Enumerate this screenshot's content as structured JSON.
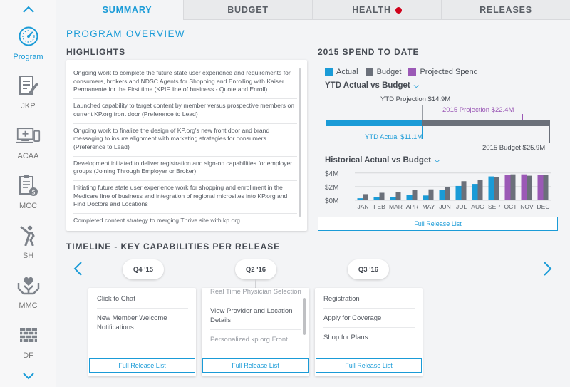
{
  "sidebar": {
    "items": [
      {
        "label": "Program",
        "icon": "gauge-icon"
      },
      {
        "label": "JKP",
        "icon": "document-pen-icon"
      },
      {
        "label": "ACAA",
        "icon": "devices-icon"
      },
      {
        "label": "MCC",
        "icon": "clipboard-dollar-icon"
      },
      {
        "label": "SH",
        "icon": "stretching-person-icon"
      },
      {
        "label": "MMC",
        "icon": "heart-hands-icon"
      },
      {
        "label": "DF",
        "icon": "bricks-icon"
      }
    ]
  },
  "tabs": [
    {
      "label": "SUMMARY"
    },
    {
      "label": "BUDGET"
    },
    {
      "label": "HEALTH"
    },
    {
      "label": "RELEASES"
    }
  ],
  "colors": {
    "accent": "#1a9bd7",
    "actual": "#1a9bd7",
    "budget": "#6b707a",
    "projected": "#9b59b6",
    "health_status": "#d0021b"
  },
  "page_title": "PROGRAM OVERVIEW",
  "highlights": {
    "title": "HIGHLIGHTS",
    "items": [
      "Ongoing work to complete the future state user experience and requirements for consumers, brokers and NDSC Agents for Shopping and Enrolling with Kaiser Permanente for the First time (KPIF line of business - Quote and Enroll)",
      "Launched capability to target content by member versus prospective members on current KP.org front door (Preference to Lead)",
      "Ongoing work to finalize the design of KP.org's new front door and brand messaging to insure alignment with marketing strategies for consumers (Preference to Lead)",
      "Development initiated to deliver registration and sign-on capabilities for employer groups (Joining Through Employer or Broker)",
      "Initiating future state user experience work for shopping and enrollment in the Medicare line of business and integration of regional microsites into KP.org and Find Doctors and Locations",
      "Completed content strategy to merging Thrive site with kp.org."
    ]
  },
  "spend": {
    "title": "2015 SPEND TO DATE",
    "legend": [
      {
        "label": "Actual"
      },
      {
        "label": "Budget"
      },
      {
        "label": "Projected Spend"
      }
    ],
    "ytd": {
      "title": "YTD Actual vs Budget",
      "projection_label": "YTD Projection",
      "projection_value": "$14.9M",
      "projection_2015_label": "2015 Projection",
      "projection_2015_value": "$22.4M",
      "actual_label": "YTD Actual",
      "actual_value": "$11.1M",
      "budget_label": "2015 Budget",
      "budget_value": "$25.9M",
      "actual_fraction": 0.43
    },
    "historical": {
      "title": "Historical Actual vs Budget"
    },
    "button": "Full Release List"
  },
  "chart_data": {
    "type": "bar",
    "title": "Historical Actual vs Budget",
    "categories": [
      "JAN",
      "FEB",
      "MAR",
      "APR",
      "MAY",
      "JUN",
      "JUL",
      "AUG",
      "SEP",
      "OCT",
      "NOV",
      "DEC"
    ],
    "y_ticks": [
      "$0M",
      "$2M",
      "$4M"
    ],
    "ylim": [
      0,
      4.5
    ],
    "series": [
      {
        "name": "Actual",
        "values": [
          0.3,
          0.5,
          0.5,
          0.8,
          0.7,
          1.5,
          2.1,
          2.4,
          3.5,
          null,
          null,
          null
        ]
      },
      {
        "name": "Budget",
        "values": [
          0.9,
          1.1,
          1.2,
          1.5,
          1.6,
          1.9,
          2.8,
          3.0,
          3.4,
          3.8,
          3.6,
          3.7
        ]
      },
      {
        "name": "Projected Spend",
        "values": [
          null,
          null,
          null,
          null,
          null,
          null,
          null,
          null,
          null,
          3.7,
          3.8,
          3.7
        ]
      }
    ]
  },
  "timeline": {
    "title": "TIMELINE - KEY CAPABILITIES PER RELEASE",
    "releases": [
      {
        "label": "Q4 '15",
        "items": [
          "Click to Chat",
          "New Member Welcome Notifications"
        ],
        "button": "Full Release List"
      },
      {
        "label": "Q2 '16",
        "items": [
          "Real Time Physician Selection",
          "View Provider and Location Details",
          "Personalized kp.org Front"
        ],
        "button": "Full Release List"
      },
      {
        "label": "Q3 '16",
        "items": [
          "Registration",
          "Apply for Coverage",
          "Shop for Plans"
        ],
        "button": "Full Release List"
      }
    ]
  }
}
